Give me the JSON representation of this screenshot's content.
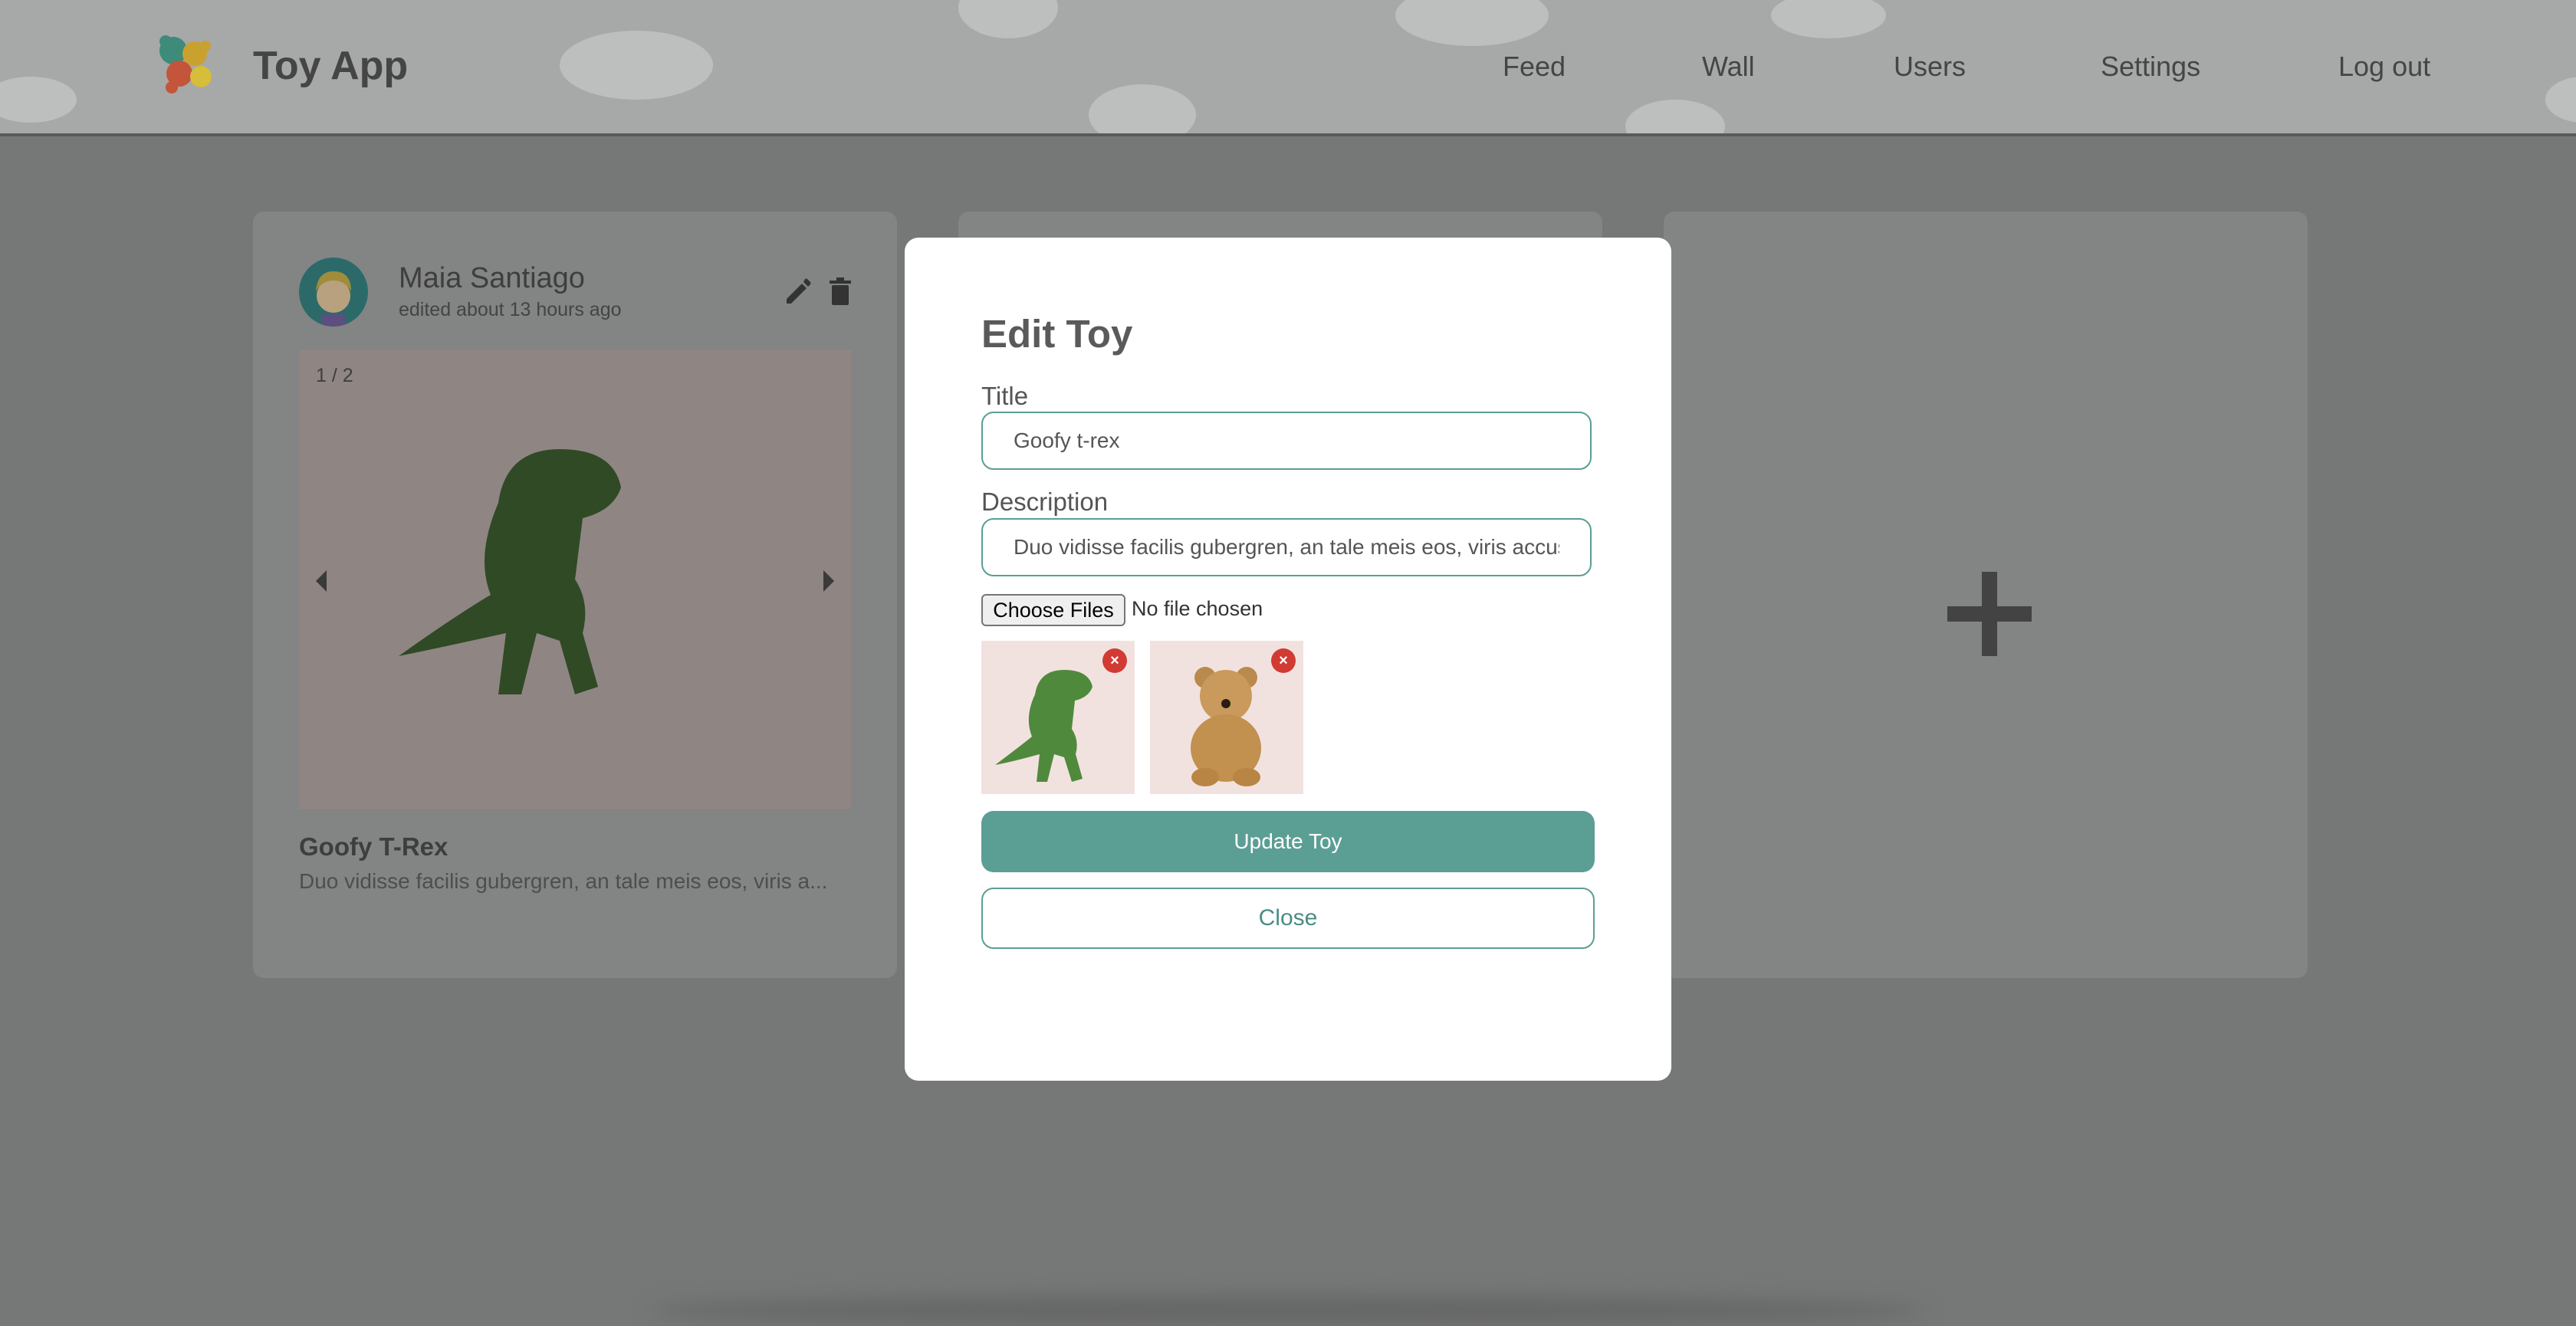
{
  "header": {
    "app_title": "Toy App",
    "nav": [
      {
        "label": "Feed"
      },
      {
        "label": "Wall"
      },
      {
        "label": "Users"
      },
      {
        "label": "Settings"
      },
      {
        "label": "Log out"
      }
    ]
  },
  "card": {
    "user_name": "Maia Santiago",
    "time": "edited about 13 hours ago",
    "counter": "1 / 2",
    "title": "Goofy T-Rex",
    "description": "Duo vidisse facilis gubergren, an tale meis eos, viris a..."
  },
  "modal": {
    "title": "Edit Toy",
    "title_label": "Title",
    "title_value": "Goofy t-rex",
    "description_label": "Description",
    "description_value": "Duo vidisse facilis gubergren, an tale meis eos, viris accus",
    "choose_files": "Choose Files",
    "no_file": "No file chosen",
    "remove_symbol": "×",
    "update_button": "Update Toy",
    "close_button": "Close"
  },
  "colors": {
    "accent": "#5b9e94",
    "remove": "#d23a34",
    "overlay": "#767777"
  },
  "icons": [
    "puzzle-logo-icon",
    "pencil-icon",
    "trash-icon",
    "chevron-left-icon",
    "chevron-right-icon",
    "plus-icon",
    "close-icon"
  ]
}
